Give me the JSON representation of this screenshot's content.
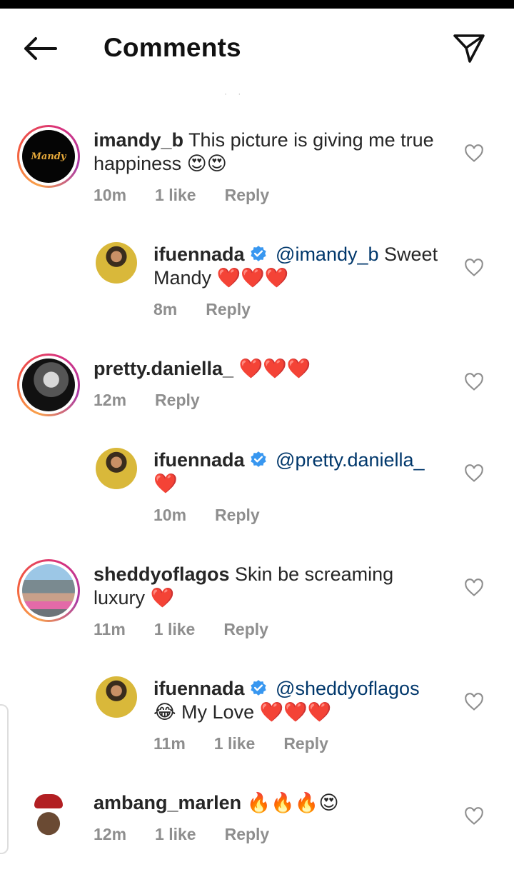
{
  "header": {
    "title": "Comments",
    "back_icon": "arrow-left-icon",
    "send_icon": "paper-plane-icon"
  },
  "comments": [
    {
      "username": "imandy_b",
      "text": "This picture is giving me true",
      "text2": "happiness 😍😍",
      "time": "10m",
      "likes": "1 like",
      "reply": "Reply",
      "avatar_text": "Mandy"
    },
    {
      "username": "ifuennada",
      "mention": "@imandy_b",
      "text": "Sweet",
      "text2": "Mandy",
      "hearts": "❤️❤️❤️",
      "time": "8m",
      "reply": "Reply"
    },
    {
      "username": "pretty.daniella_",
      "hearts": "❤️❤️❤️",
      "time": "12m",
      "reply": "Reply"
    },
    {
      "username": "ifuennada",
      "mention": "@pretty.daniella_",
      "hearts": "❤️",
      "time": "10m",
      "reply": "Reply"
    },
    {
      "username": "sheddyoflagos",
      "text": "Skin be screaming",
      "text2": "luxury",
      "hearts": "❤️",
      "time": "11m",
      "likes": "1 like",
      "reply": "Reply"
    },
    {
      "username": "ifuennada",
      "mention": "@sheddyoflagos",
      "text2": "😂 My Love",
      "hearts": "❤️❤️❤️",
      "time": "11m",
      "likes": "1 like",
      "reply": "Reply"
    },
    {
      "username": "ambang_marlen",
      "text": "🔥🔥🔥😍",
      "time": "12m",
      "likes": "1 like",
      "reply": "Reply"
    }
  ],
  "colors": {
    "mention": "#00376b",
    "meta": "#8e8e8e",
    "verified": "#3897f0",
    "heart": "#e0142b"
  }
}
